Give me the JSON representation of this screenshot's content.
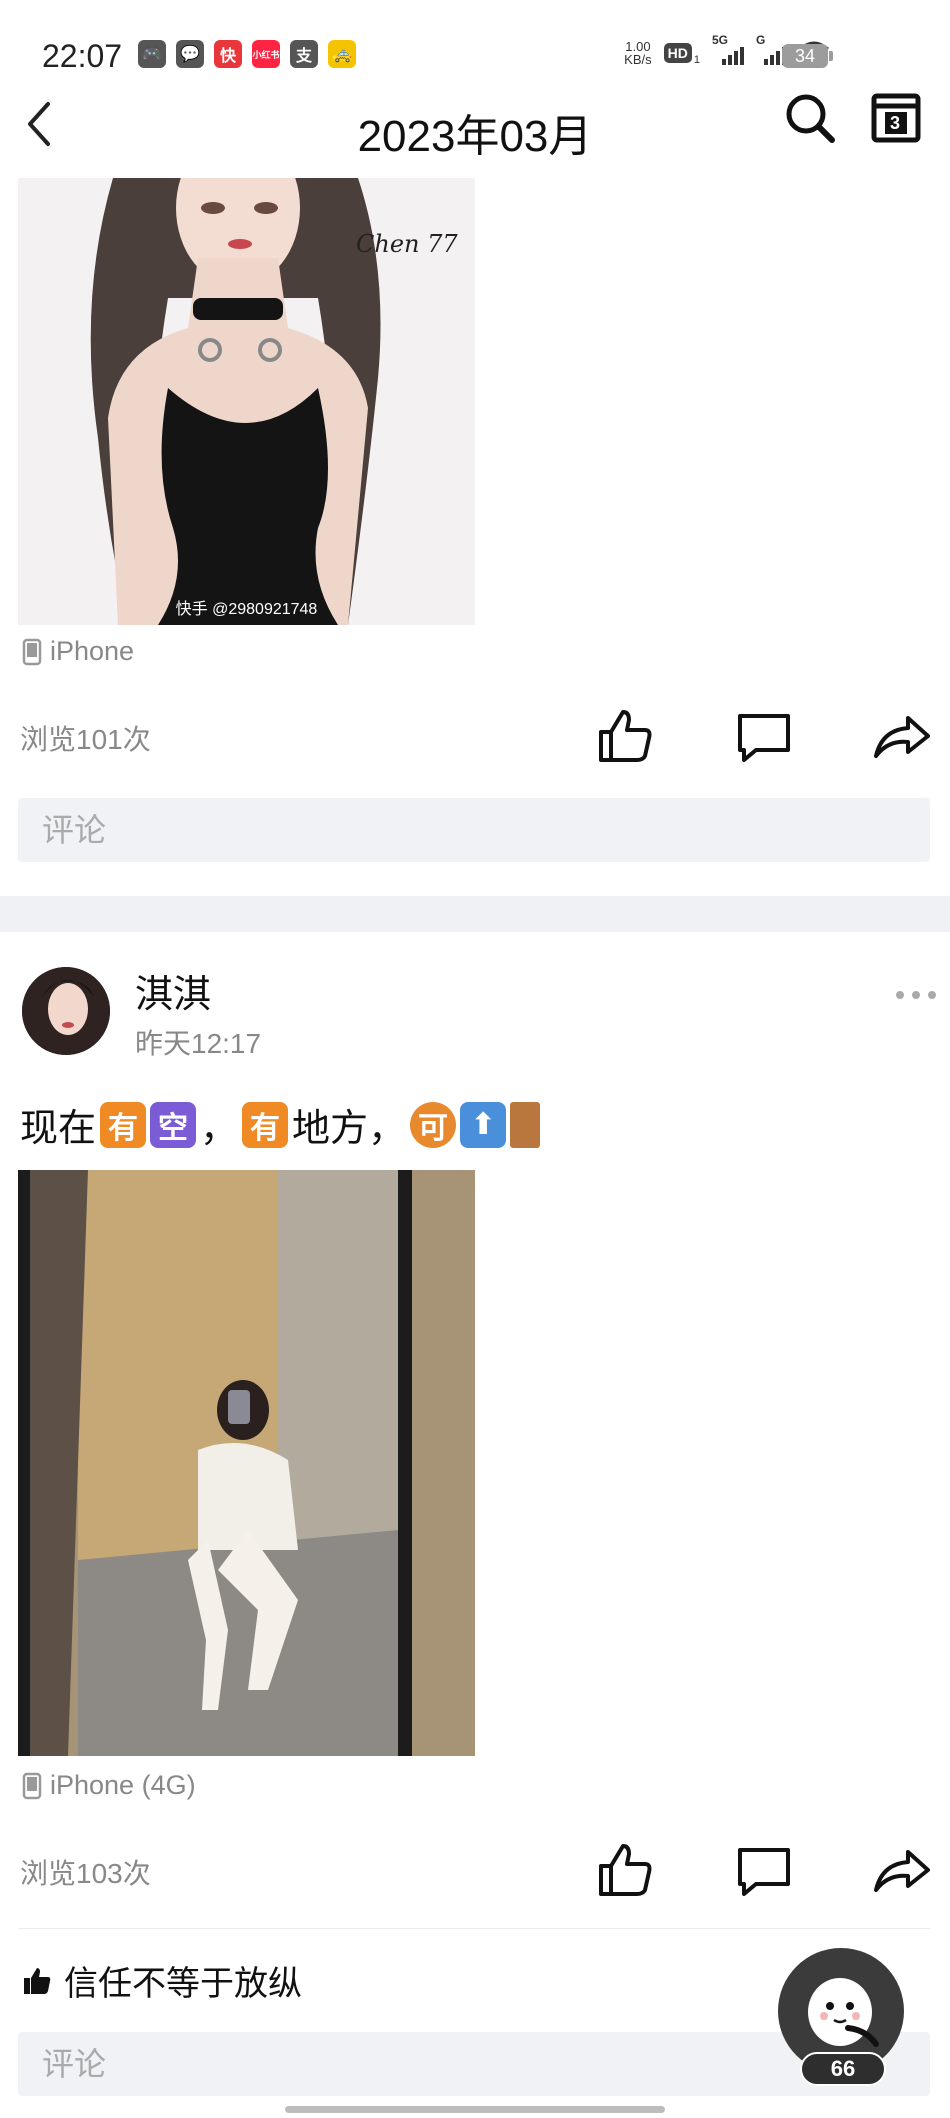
{
  "status_bar": {
    "time": "22:07",
    "net_speed_value": "1.00",
    "net_speed_unit": "KB/s",
    "hd_label": "HD",
    "hd_sub": "1",
    "signal_1_label": "5G",
    "signal_2_label": "G",
    "battery": "34",
    "app_icons": [
      "game-icon",
      "wechat-icon",
      "kuaishou-icon",
      "xiaohongshu-icon",
      "alipay-icon",
      "taxi-icon"
    ]
  },
  "nav": {
    "title": "2023年03月",
    "icons": [
      "back-icon",
      "search-icon",
      "calendar-icon"
    ],
    "calendar_glyph": "3"
  },
  "posts": [
    {
      "image_watermark": "快手 @2980921748",
      "image_signature": "Chen 77",
      "device": "iPhone",
      "views": "浏览101次",
      "comment_placeholder": "评论"
    },
    {
      "author": "淇淇",
      "time": "昨天12:17",
      "text_parts": [
        "现在",
        "有",
        "空",
        "，",
        "有",
        "地方，",
        "可",
        "⬆",
        ""
      ],
      "device": "iPhone (4G)",
      "views": "浏览103次",
      "liked_by": "信任不等于放纵",
      "comment_placeholder": "评论"
    }
  ],
  "float_badge": "66",
  "colors": {
    "comment_bg": "#f1f2f5",
    "divider": "#f0f1f4",
    "muted_text": "#888888",
    "emoji_orange": "#f08a24",
    "emoji_purple": "#7b5bd6",
    "emoji_blue": "#4a8fd9"
  }
}
